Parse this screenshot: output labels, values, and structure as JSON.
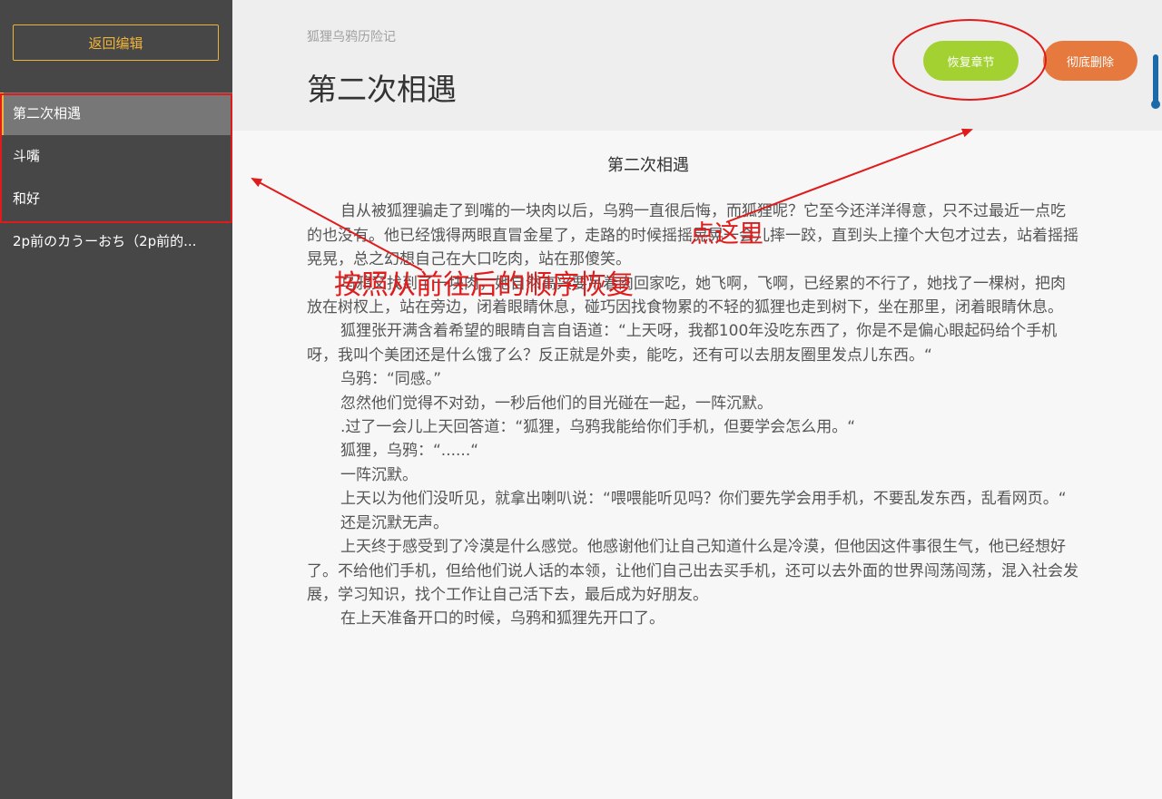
{
  "sidebar": {
    "back_label": "返回编辑",
    "chapters": [
      {
        "label": "第二次相遇",
        "active": true
      },
      {
        "label": "斗嘴",
        "active": false
      },
      {
        "label": "和好",
        "active": false
      },
      {
        "label": "2p前のカうーおち（2p前的...",
        "active": false
      }
    ]
  },
  "header": {
    "book_title": "狐狸乌鸦历险记",
    "chapter_title": "第二次相遇",
    "restore_label": "恢复章节",
    "delete_label": "彻底删除"
  },
  "content": {
    "title": "第二次相遇",
    "paragraphs": [
      "自从被狐狸骗走了到嘴的一块肉以后，乌鸦一直很后悔，而狐狸呢？它至今还洋洋得意，只不过最近一点吃的也没有。他已经饿得两眼直冒金星了，走路的时候摇摇晃晃一会儿摔一跤，直到头上撞个大包才过去，站着摇摇晃晃，总之幻想自己在大口吃肉，站在那傻笑。",
      "乌鸦又找到了一块肉，她自然高兴要吊着肉回家吃，她飞啊，飞啊，已经累的不行了，她找了一棵树，把肉放在树杈上，站在旁边，闭着眼睛休息，碰巧因找食物累的不轻的狐狸也走到树下，坐在那里，闭着眼睛休息。",
      "狐狸张开满含着希望的眼睛自言自语道：“上天呀，我都100年没吃东西了，你是不是偏心眼起码给个手机呀，我叫个美团还是什么饿了么？反正就是外卖，能吃，还有可以去朋友圈里发点儿东西。“",
      "乌鸦：“同感。”",
      "忽然他们觉得不对劲，一秒后他们的目光碰在一起，一阵沉默。",
      ".过了一会儿上天回答道：“狐狸，乌鸦我能给你们手机，但要学会怎么用。“",
      "狐狸，乌鸦：“......“",
      "一阵沉默。",
      "上天以为他们没听见，就拿出喇叭说：“喂喂能听见吗？你们要先学会用手机，不要乱发东西，乱看网页。“",
      "还是沉默无声。",
      "上天终于感受到了冷漠是什么感觉。他感谢他们让自己知道什么是冷漠，但他因这件事很生气，他已经想好了。不给他们手机，但给他们说人话的本领，让他们自己出去买手机，还可以去外面的世界闯荡闯荡，混入社会发展，学习知识，找个工作让自己活下去，最后成为好朋友。",
      "在上天准备开口的时候，乌鸦和狐狸先开口了。"
    ]
  },
  "annotations": {
    "click_here": "点这里",
    "restore_order": "按照从前往后的顺序恢复",
    "color": "#e01b1b"
  },
  "colors": {
    "sidebar_bg": "#474747",
    "accent": "#f0b43a",
    "restore_btn": "#a3d132",
    "delete_btn": "#e67a3e"
  }
}
